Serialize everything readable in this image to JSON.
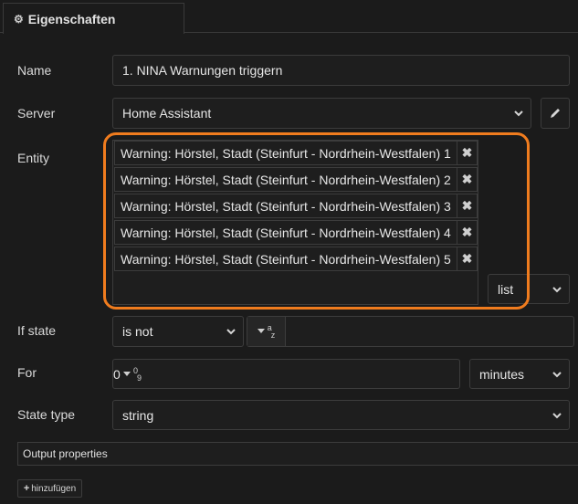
{
  "tab": {
    "label": "Eigenschaften",
    "icon": "gear-icon"
  },
  "fields": {
    "name": {
      "label": "Name",
      "value": "1. NINA Warnungen triggern"
    },
    "server": {
      "label": "Server",
      "value": "Home Assistant"
    },
    "entity": {
      "label": "Entity",
      "items": [
        "Warning: Hörstel, Stadt (Steinfurt - Nordrhein-Westfalen) 1",
        "Warning: Hörstel, Stadt (Steinfurt - Nordrhein-Westfalen) 2",
        "Warning: Hörstel, Stadt (Steinfurt - Nordrhein-Westfalen) 3",
        "Warning: Hörstel, Stadt (Steinfurt - Nordrhein-Westfalen) 4",
        "Warning: Hörstel, Stadt (Steinfurt - Nordrhein-Westfalen) 5"
      ],
      "remove_symbol": "✖",
      "mode": "list"
    },
    "if_state": {
      "label": "If state",
      "operator": "is not",
      "type_icon": "string-type-icon",
      "type_glyph_top": "a",
      "type_glyph_bottom": "z",
      "value": ""
    },
    "for": {
      "label": "For",
      "type_icon": "number-type-icon",
      "type_glyph_top": "0",
      "type_glyph_bottom": "9",
      "value": "0",
      "unit": "minutes"
    },
    "state_type": {
      "label": "State type",
      "value": "string"
    }
  },
  "output": {
    "header": "Output properties"
  },
  "add_button": {
    "label": "hinzufügen",
    "icon": "plus-icon"
  },
  "colors": {
    "highlight": "#f07c1e",
    "background": "#1b1b1b",
    "border": "#3c3c3c"
  }
}
